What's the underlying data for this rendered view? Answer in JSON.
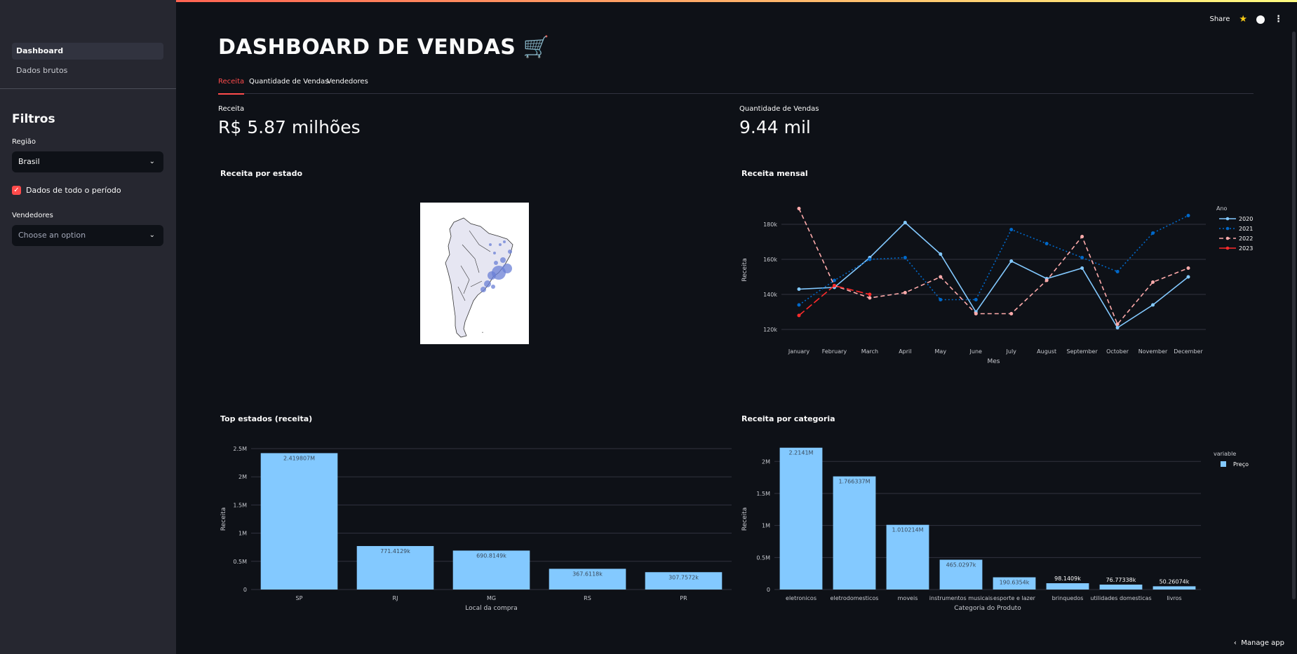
{
  "sidebar": {
    "nav": [
      {
        "label": "Dashboard",
        "active": true
      },
      {
        "label": "Dados brutos",
        "active": false
      }
    ],
    "filters_title": "Filtros",
    "region_label": "Região",
    "region_value": "Brasil",
    "all_period_label": "Dados de todo o período",
    "all_period_checked": true,
    "sellers_label": "Vendedores",
    "sellers_placeholder": "Choose an option"
  },
  "header": {
    "share": "Share",
    "icons": [
      "star-icon",
      "github-icon",
      "kebab-menu-icon"
    ]
  },
  "main": {
    "title": "DASHBOARD DE VENDAS 🛒",
    "tabs": [
      "Receita",
      "Quantidade de Vendas",
      "Vendedores"
    ],
    "active_tab": "Receita",
    "metrics": [
      {
        "label": "Receita",
        "value": "R$ 5.87 milhões"
      },
      {
        "label": "Quantidade de Vendas",
        "value": "9.44 mil"
      }
    ]
  },
  "footer": {
    "manage_app": "Manage app"
  },
  "colors": {
    "accent": "#ff4b4b",
    "bar": "#83c9ff",
    "bg": "#0e1117",
    "sidebar": "#262730"
  },
  "chart_data": [
    {
      "type": "scatter",
      "title": "Receita por estado",
      "note": "bubble map of South America (states of Brazil)"
    },
    {
      "type": "line",
      "title": "Receita mensal",
      "xlabel": "Mes",
      "ylabel": "Receita",
      "legend_title": "Ano",
      "categories": [
        "January",
        "February",
        "March",
        "April",
        "May",
        "June",
        "July",
        "August",
        "September",
        "October",
        "November",
        "December"
      ],
      "yticks": [
        120000,
        140000,
        160000,
        180000
      ],
      "ytick_labels": [
        "120k",
        "140k",
        "160k",
        "180k"
      ],
      "ylim": [
        116000,
        192000
      ],
      "series": [
        {
          "name": "2020",
          "color": "#83c9ff",
          "dash": "",
          "values": [
            143000,
            144000,
            161000,
            181000,
            163000,
            130000,
            159000,
            149000,
            155000,
            121000,
            134000,
            150000
          ]
        },
        {
          "name": "2021",
          "color": "#0068c9",
          "dash": "2,3",
          "values": [
            134000,
            148000,
            160000,
            161000,
            137000,
            137000,
            177000,
            169000,
            161000,
            153000,
            175000,
            185000
          ]
        },
        {
          "name": "2022",
          "color": "#ffabab",
          "dash": "6,4",
          "values": [
            189000,
            145000,
            138000,
            141000,
            150000,
            129000,
            129000,
            148000,
            173000,
            123000,
            147000,
            155000
          ]
        },
        {
          "name": "2023",
          "color": "#ff2b2b",
          "dash": "10,4",
          "values": [
            128000,
            145000,
            140000,
            null,
            null,
            null,
            null,
            null,
            null,
            null,
            null,
            null
          ]
        }
      ]
    },
    {
      "type": "bar",
      "title": "Top estados (receita)",
      "xlabel": "Local da compra",
      "ylabel": "Receita",
      "categories": [
        "SP",
        "RJ",
        "MG",
        "RS",
        "PR"
      ],
      "values": [
        2419807,
        771412.9,
        690814.9,
        367611.8,
        307757.2
      ],
      "labels": [
        "2.419807M",
        "771.4129k",
        "690.8149k",
        "367.6118k",
        "307.7572k"
      ],
      "yticks": [
        0,
        500000,
        1000000,
        1500000,
        2000000,
        2500000
      ],
      "ytick_labels": [
        "0",
        "0.5M",
        "1M",
        "1.5M",
        "2M",
        "2.5M"
      ],
      "ylim": [
        0,
        2500000
      ]
    },
    {
      "type": "bar",
      "title": "Receita por categoria",
      "xlabel": "Categoria do Produto",
      "ylabel": "Receita",
      "legend_title": "variable",
      "series_name": "Preço",
      "categories": [
        "eletronicos",
        "eletrodomesticos",
        "moveis",
        "instrumentos musicais",
        "esporte e lazer",
        "brinquedos",
        "utilidades domesticas",
        "livros"
      ],
      "values": [
        2214100,
        1766337,
        1010214,
        465029.7,
        190635.4,
        98140.9,
        76773.38,
        50260.74
      ],
      "labels": [
        "2.2141M",
        "1.766337M",
        "1.010214M",
        "465.0297k",
        "190.6354k",
        "98.1409k",
        "76.77338k",
        "50.26074k"
      ],
      "yticks": [
        0,
        500000,
        1000000,
        1500000,
        2000000
      ],
      "ytick_labels": [
        "0",
        "0.5M",
        "1M",
        "1.5M",
        "2M"
      ],
      "ylim": [
        0,
        2200000
      ]
    }
  ]
}
